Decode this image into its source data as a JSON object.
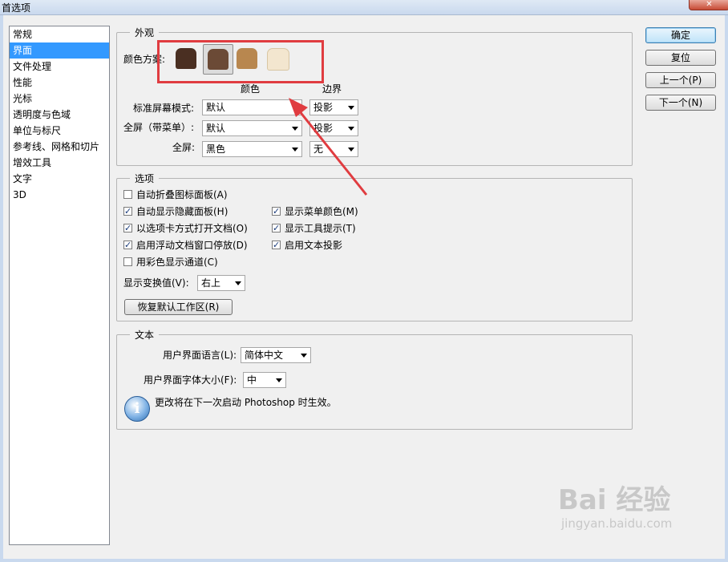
{
  "window": {
    "title": "首选项"
  },
  "sidebar": {
    "items": [
      {
        "label": "常规",
        "selected": false
      },
      {
        "label": "界面",
        "selected": true
      },
      {
        "label": "文件处理",
        "selected": false
      },
      {
        "label": "性能",
        "selected": false
      },
      {
        "label": "光标",
        "selected": false
      },
      {
        "label": "透明度与色域",
        "selected": false
      },
      {
        "label": "单位与标尺",
        "selected": false
      },
      {
        "label": "参考线、网格和切片",
        "selected": false
      },
      {
        "label": "增效工具",
        "selected": false
      },
      {
        "label": "文字",
        "selected": false
      },
      {
        "label": "3D",
        "selected": false
      }
    ]
  },
  "appearance": {
    "title": "外观",
    "color_scheme_label": "颜色方案:",
    "swatches": [
      {
        "color": "#4a2f22",
        "selected": false
      },
      {
        "color": "#6b4a36",
        "selected": true
      },
      {
        "color": "#b8874f",
        "selected": false
      },
      {
        "color": "#f3e6cf",
        "selected": false
      }
    ],
    "col_color": "颜色",
    "col_border": "边界",
    "rows": [
      {
        "label": "标准屏幕模式:",
        "color": "默认",
        "border": "投影"
      },
      {
        "label": "全屏（带菜单）:",
        "color": "默认",
        "border": "投影"
      },
      {
        "label": "全屏:",
        "color": "黑色",
        "border": "无"
      }
    ]
  },
  "options": {
    "title": "选项",
    "checkboxes": [
      {
        "label": "自动折叠图标面板(A)",
        "checked": false
      },
      {
        "label": "自动显示隐藏面板(H)",
        "checked": true
      },
      {
        "label": "以选项卡方式打开文档(O)",
        "checked": true
      },
      {
        "label": "启用浮动文档窗口停放(D)",
        "checked": true
      },
      {
        "label": "用彩色显示通道(C)",
        "checked": false
      },
      {
        "label": "显示菜单颜色(M)",
        "checked": true
      },
      {
        "label": "显示工具提示(T)",
        "checked": true
      },
      {
        "label": "启用文本投影",
        "checked": true
      }
    ],
    "transform_label": "显示变换值(V):",
    "transform_value": "右上",
    "reset_workspace": "恢复默认工作区(R)"
  },
  "text": {
    "title": "文本",
    "ui_language_label": "用户界面语言(L):",
    "ui_language_value": "简体中文",
    "ui_font_size_label": "用户界面字体大小(F):",
    "ui_font_size_value": "中",
    "note": "更改将在下一次启动 Photoshop 时生效。"
  },
  "buttons": {
    "ok": "确定",
    "reset": "复位",
    "prev": "上一个(P)",
    "next": "下一个(N)"
  },
  "watermark": {
    "brand": "Bai  经验",
    "url": "jingyan.baidu.com"
  },
  "colors": {
    "selection": "#3399ff",
    "annotation": "#e03c40"
  }
}
